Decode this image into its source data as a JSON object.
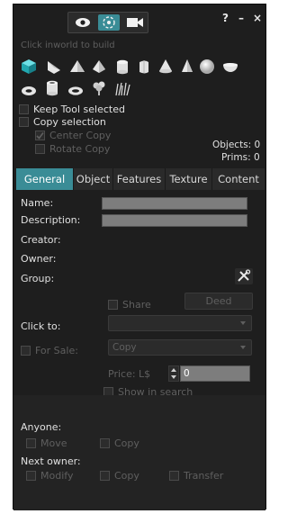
{
  "toolbar": {
    "title_buttons": {
      "help": "?",
      "minimize": "–",
      "close": "×"
    },
    "modes": [
      "eye-icon",
      "focus-icon",
      "camera-icon"
    ],
    "hint": "Click inworld to build"
  },
  "shapes_row1": [
    "cube-icon",
    "wedge-icon",
    "pyramid-icon",
    "tetrahedron-icon",
    "cylinder-icon",
    "half-cylinder-icon",
    "cone-icon",
    "half-cone-icon",
    "sphere-icon",
    "hemisphere-icon"
  ],
  "shapes_row2": [
    "torus-icon",
    "tube-icon",
    "ring-icon",
    "tree-icon",
    "grass-icon"
  ],
  "options": {
    "keep_tool": "Keep Tool selected",
    "copy_selection": "Copy selection",
    "center_copy": "Center Copy",
    "rotate_copy": "Rotate Copy",
    "objects": "Objects: 0",
    "prims": "Prims: 0"
  },
  "tabs": [
    "General",
    "Object",
    "Features",
    "Texture",
    "Content"
  ],
  "general": {
    "name": "Name:",
    "description": "Description:",
    "creator": "Creator:",
    "owner": "Owner:",
    "group": "Group:",
    "share": "Share",
    "deed": "Deed",
    "click_to": "Click to:",
    "for_sale": "For Sale:",
    "sale_type": "Copy",
    "price_label": "Price: L$",
    "price_value": "0",
    "show_in_search": "Show in search"
  },
  "perms": {
    "anyone": "Anyone:",
    "move": "Move",
    "copy": "Copy",
    "next_owner": "Next owner:",
    "modify": "Modify",
    "copy2": "Copy",
    "transfer": "Transfer"
  },
  "colors": {
    "accent": "#3a8c96",
    "shape_blue": "#22a8b0",
    "bg": "#1e1e1e"
  }
}
